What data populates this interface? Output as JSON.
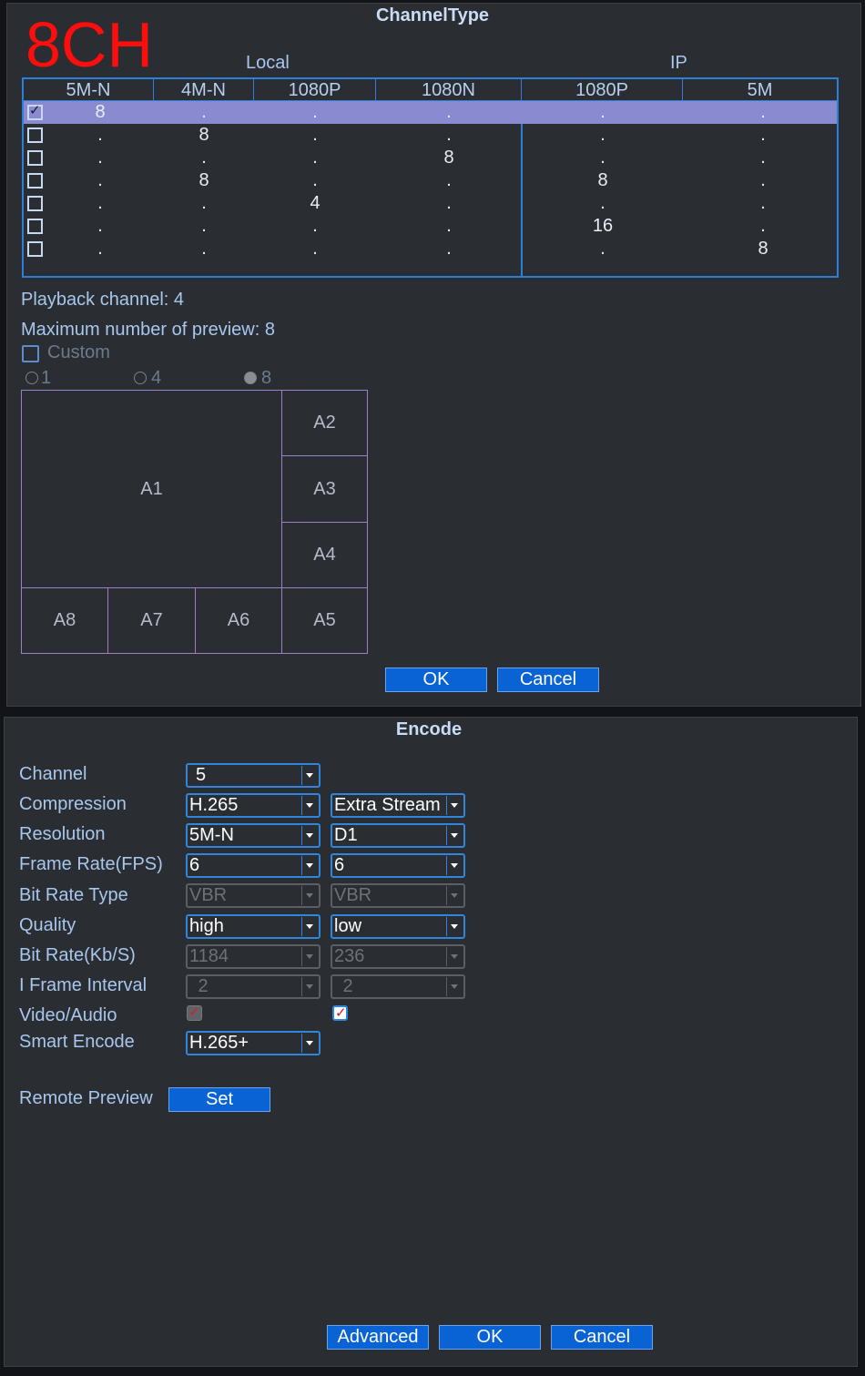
{
  "channel_type": {
    "title": "ChannelType",
    "badge": "8CH",
    "group_local": "Local",
    "group_ip": "IP",
    "columns": [
      "5M-N",
      "4M-N",
      "1080P",
      "1080N",
      "1080P",
      "5M"
    ],
    "rows": [
      {
        "checked": true,
        "cells": [
          "8",
          ".",
          ".",
          ".",
          ".",
          "."
        ]
      },
      {
        "checked": false,
        "cells": [
          ".",
          "8",
          ".",
          ".",
          ".",
          "."
        ]
      },
      {
        "checked": false,
        "cells": [
          ".",
          ".",
          ".",
          "8",
          ".",
          "."
        ]
      },
      {
        "checked": false,
        "cells": [
          ".",
          "8",
          ".",
          ".",
          "8",
          "."
        ]
      },
      {
        "checked": false,
        "cells": [
          ".",
          ".",
          "4",
          ".",
          ".",
          "."
        ]
      },
      {
        "checked": false,
        "cells": [
          ".",
          ".",
          ".",
          ".",
          "16",
          "."
        ]
      },
      {
        "checked": false,
        "cells": [
          ".",
          ".",
          ".",
          ".",
          ".",
          "8"
        ]
      }
    ],
    "playback_channel": "Playback channel: 4",
    "max_preview": "Maximum number of preview: 8",
    "custom_label": "Custom",
    "radio_options": [
      "1",
      "4",
      "8"
    ],
    "radio_selected": "8",
    "layout_cells": [
      "A1",
      "A2",
      "A3",
      "A4",
      "A5",
      "A6",
      "A7",
      "A8"
    ],
    "ok_label": "OK",
    "cancel_label": "Cancel"
  },
  "encode": {
    "title": "Encode",
    "labels": {
      "channel": "Channel",
      "compression": "Compression",
      "resolution": "Resolution",
      "frame_rate": "Frame Rate(FPS)",
      "bit_rate_type": "Bit Rate Type",
      "quality": "Quality",
      "bit_rate": "Bit Rate(Kb/S)",
      "i_frame": "I Frame Interval",
      "video_audio": "Video/Audio",
      "smart_encode": "Smart Encode",
      "remote_preview": "Remote Preview"
    },
    "channel": "5",
    "main": {
      "compression": "H.265",
      "resolution": "5M-N",
      "frame_rate": "6",
      "bit_rate_type": "VBR",
      "quality": "high",
      "bit_rate": "1184",
      "i_frame": "2"
    },
    "extra": {
      "stream": "Extra Stream",
      "resolution": "D1",
      "frame_rate": "6",
      "bit_rate_type": "VBR",
      "quality": "low",
      "bit_rate": "236",
      "i_frame": "2"
    },
    "smart_encode": "H.265+",
    "set_label": "Set",
    "advanced_label": "Advanced",
    "ok_label": "OK",
    "cancel_label": "Cancel"
  },
  "colors": {
    "accent_blue": "#0a63d4",
    "border_blue": "#2c7fd6",
    "selected_row": "#8a8ad0",
    "badge_red": "#ff0d0d"
  }
}
